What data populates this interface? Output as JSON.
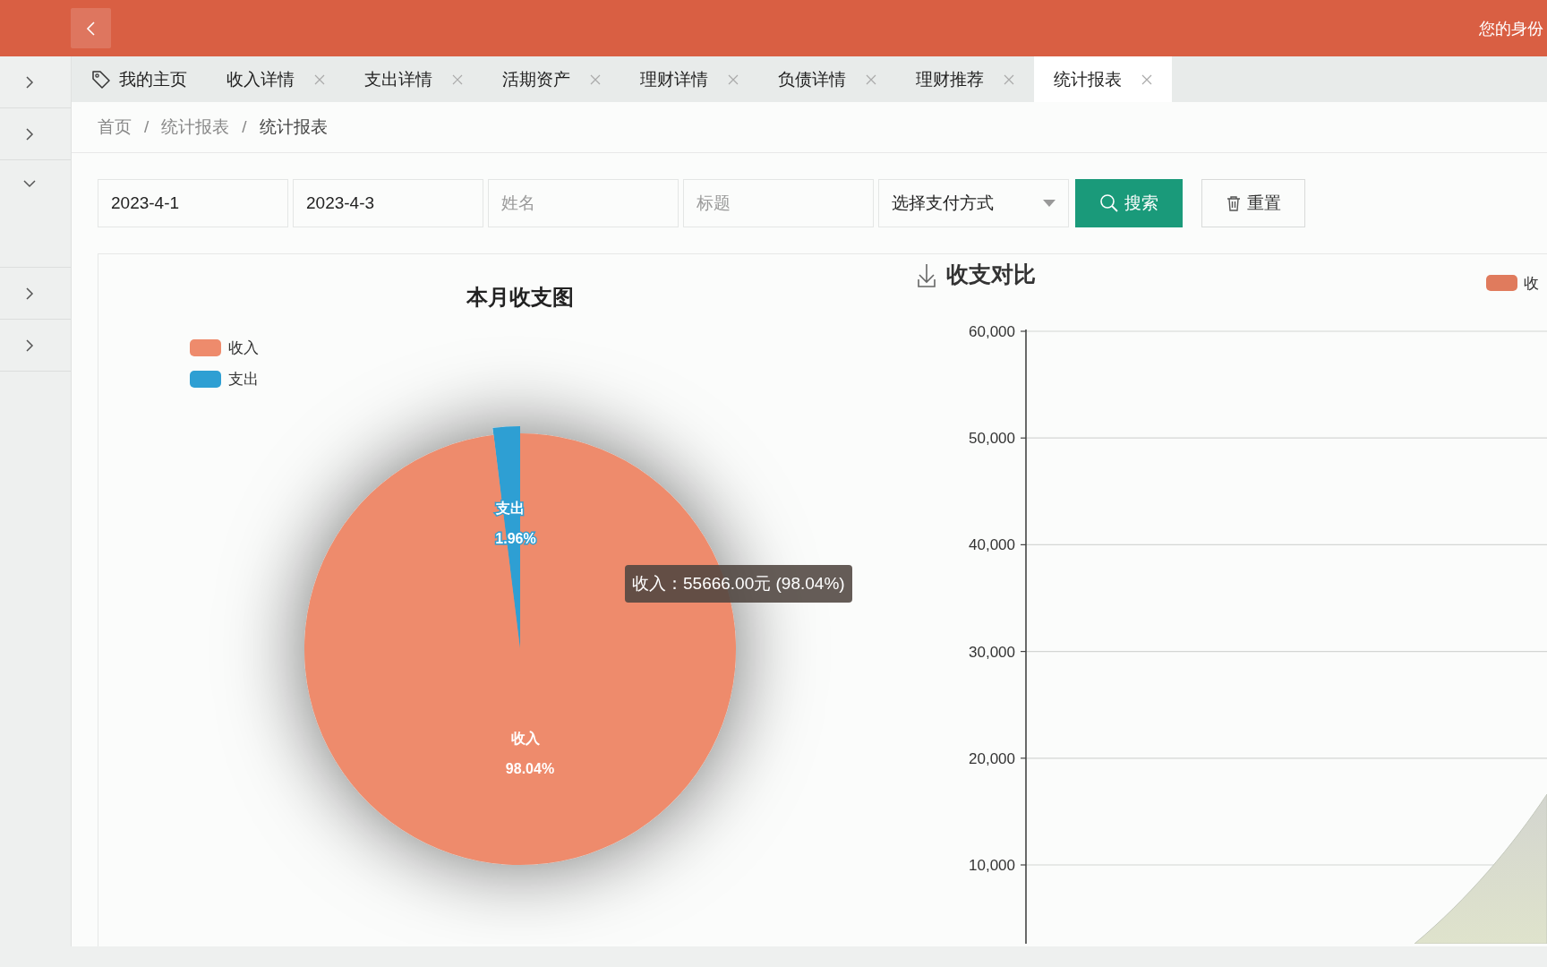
{
  "header": {
    "user_text": "您的身份"
  },
  "sidebar": {
    "items": [
      {
        "expanded": false
      },
      {
        "expanded": false
      },
      {
        "expanded": true
      },
      {
        "expanded": false
      },
      {
        "expanded": false
      }
    ]
  },
  "tabs": [
    {
      "label": "我的主页",
      "kind": "home",
      "selected": false
    },
    {
      "label": "收入详情",
      "kind": "closable",
      "selected": false
    },
    {
      "label": "支出详情",
      "kind": "closable",
      "selected": false
    },
    {
      "label": "活期资产",
      "kind": "closable",
      "selected": false
    },
    {
      "label": "理财详情",
      "kind": "closable",
      "selected": false
    },
    {
      "label": "负债详情",
      "kind": "closable",
      "selected": false
    },
    {
      "label": "理财推荐",
      "kind": "closable",
      "selected": false
    },
    {
      "label": "统计报表",
      "kind": "closable",
      "selected": true
    }
  ],
  "breadcrumb": {
    "separator": "/",
    "items": [
      {
        "label": "首页",
        "current": false
      },
      {
        "label": "统计报表",
        "current": false
      },
      {
        "label": "统计报表",
        "current": true
      }
    ]
  },
  "filters": {
    "fields": [
      {
        "value": "2023-4-1"
      },
      {
        "value": "2023-4-3"
      },
      {
        "placeholder": "姓名"
      },
      {
        "placeholder": "标题"
      }
    ],
    "select": {
      "placeholder": "选择支付方式"
    },
    "buttons": [
      {
        "label": "搜索",
        "kind": "primary"
      },
      {
        "label": "重置",
        "kind": "default"
      }
    ]
  },
  "pie_panel": {
    "chart_data": {
      "type": "pie",
      "title": "本月收支图",
      "categories": [
        "收入",
        "支出"
      ],
      "values": [
        98.04,
        1.96
      ],
      "colors": [
        "#ee8b6c",
        "#2e9fd3"
      ],
      "legend": true,
      "data_labels": "value_labels",
      "value_labels": [
        "98.04%",
        "1.96%"
      ]
    },
    "tooltip": "收入：55666.00元 (98.04%)"
  },
  "compare_panel": {
    "chart_data": {
      "type": "area",
      "title": "收支对比",
      "series": [
        {
          "name": "收",
          "color": "#e07b5d"
        }
      ],
      "ylim": [
        0,
        60000
      ],
      "grid": true,
      "yticks": [
        {
          "value": 10000,
          "label": "10,000"
        },
        {
          "value": 20000,
          "label": "20,000"
        },
        {
          "value": 30000,
          "label": "30,000"
        },
        {
          "value": 40000,
          "label": "40,000"
        },
        {
          "value": 50000,
          "label": "50,000"
        },
        {
          "value": 60000,
          "label": "60,000"
        }
      ]
    }
  }
}
